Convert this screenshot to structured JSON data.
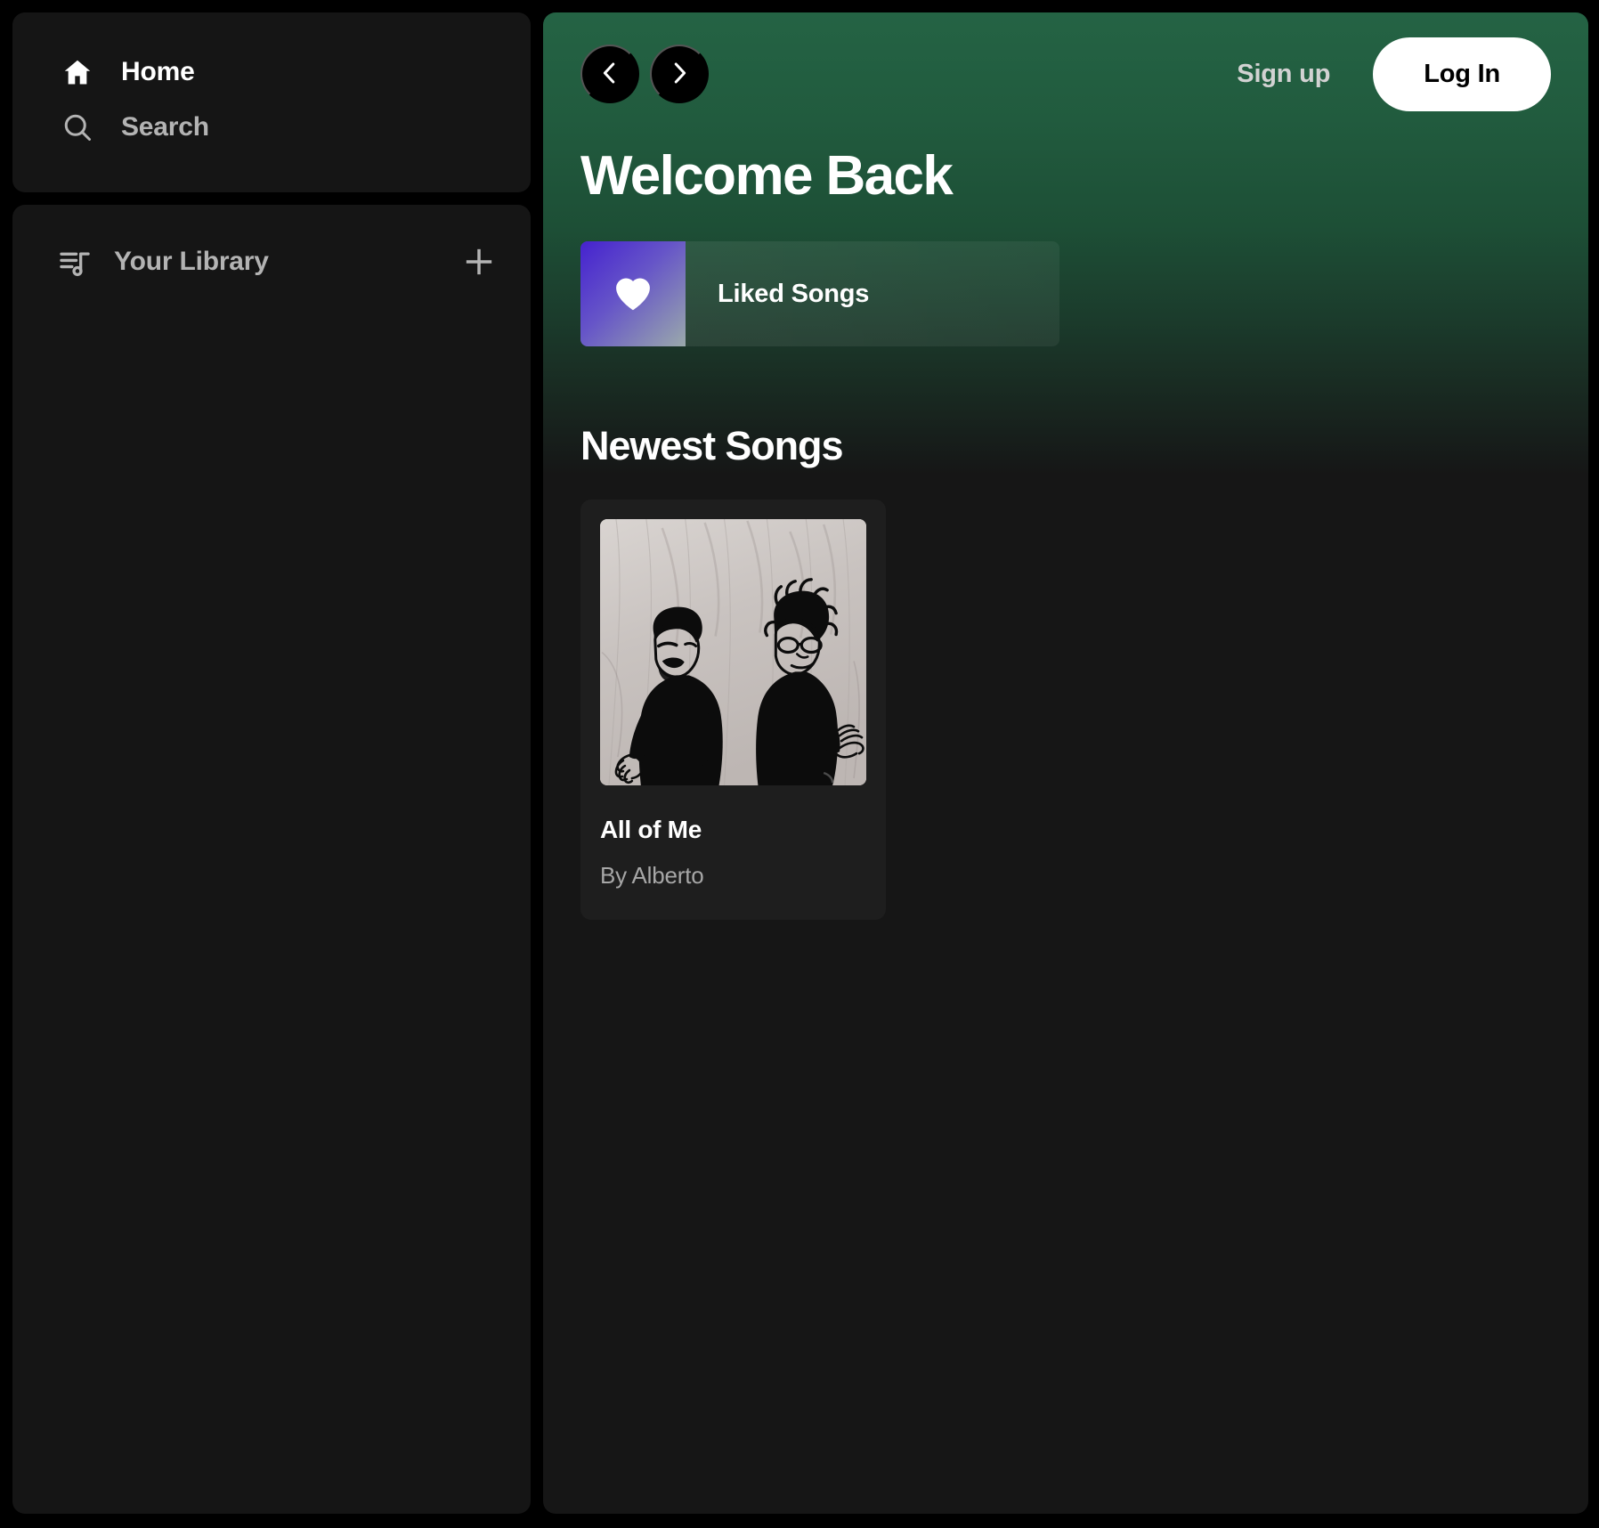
{
  "sidebar": {
    "nav": [
      {
        "label": "Home",
        "icon": "home-icon",
        "state": "active"
      },
      {
        "label": "Search",
        "icon": "search-icon",
        "state": "inactive"
      }
    ],
    "library": {
      "label": "Your Library",
      "icon": "library-playlist-icon",
      "add_icon": "plus-icon"
    }
  },
  "topbar": {
    "back_icon": "chevron-left-icon",
    "forward_icon": "chevron-right-icon",
    "signup_label": "Sign up",
    "login_label": "Log In"
  },
  "main": {
    "welcome_title": "Welcome Back",
    "liked": {
      "label": "Liked Songs",
      "icon": "heart-icon",
      "gradient_from": "#4522cf",
      "gradient_to": "#9aa9ab"
    },
    "section_title": "Newest Songs",
    "songs": [
      {
        "title": "All of Me",
        "artist": "By Alberto",
        "art_alt": "two figures in black clothing on a light textured wall"
      }
    ]
  },
  "colors": {
    "page_background": "#000000",
    "panel_background": "#151515",
    "header_gradient_top": "#246344",
    "header_gradient_bottom": "#161616",
    "card_background": "#1e1e1e",
    "text_primary": "#ffffff",
    "text_muted": "#b3b3b3",
    "accent_white": "#ffffff"
  }
}
